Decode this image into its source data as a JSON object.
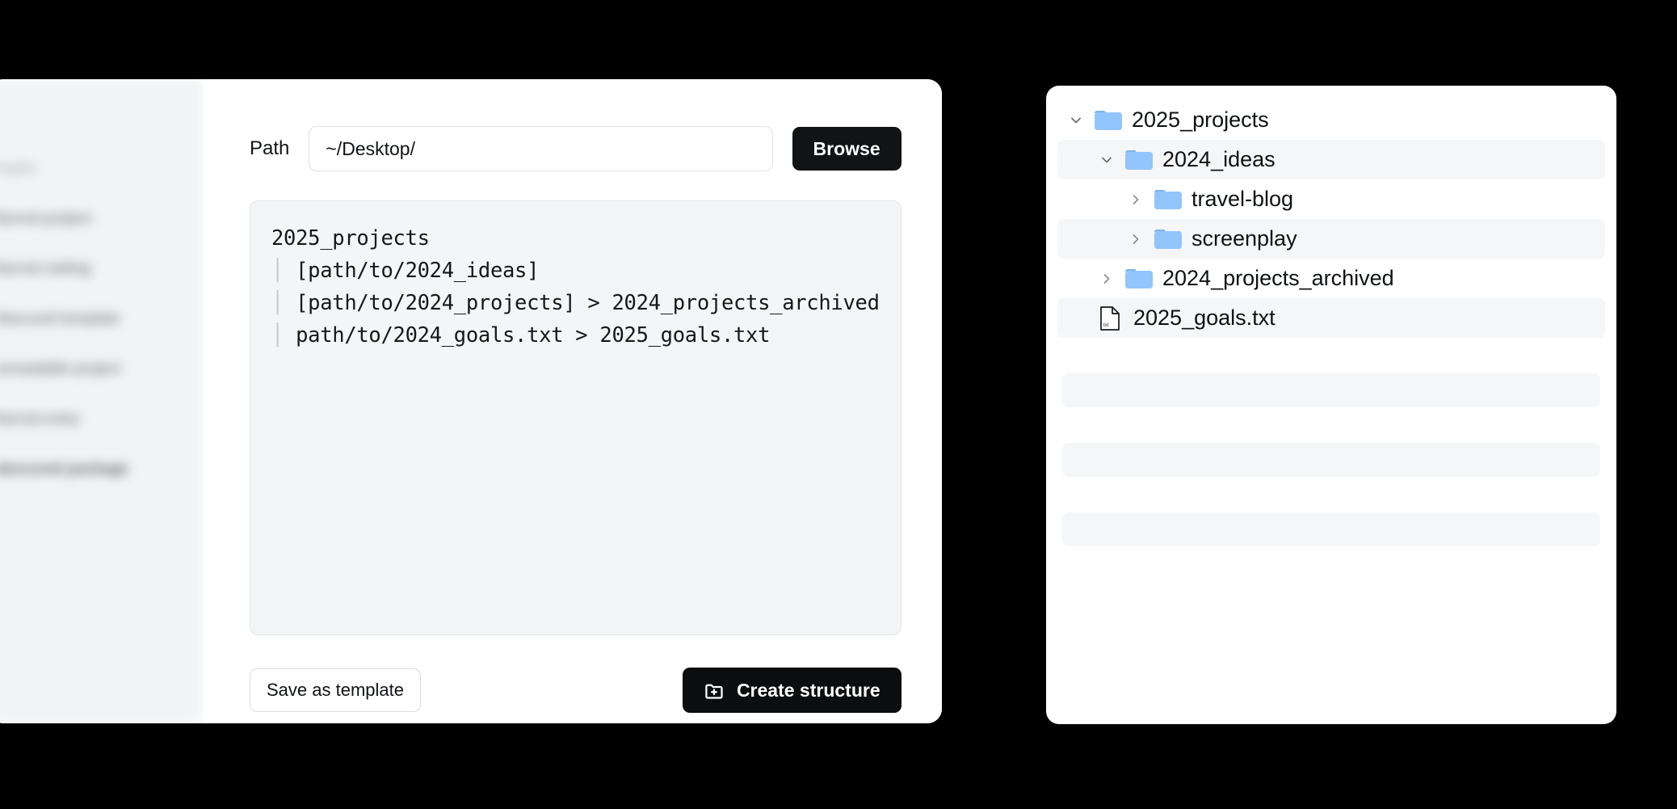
{
  "background_color": "#000000",
  "app_window": {
    "sidebar": {
      "blurred": true,
      "items": [
        {
          "label": "illegible"
        },
        {
          "label": "blurred project"
        },
        {
          "label": "blurred setting"
        },
        {
          "label": "obscured template"
        },
        {
          "label": "unreadable project"
        },
        {
          "label": "blurred entry"
        },
        {
          "label": "obscured package"
        }
      ]
    },
    "path_row": {
      "label": "Path",
      "input_value": "~/Desktop/",
      "input_placeholder": "~/Desktop/",
      "browse_label": "Browse"
    },
    "structure_editor": {
      "lines": [
        {
          "guide": "",
          "text": "2025_projects"
        },
        {
          "guide": "│ ",
          "text": "[path/to/2024_ideas]"
        },
        {
          "guide": "│ ",
          "text": "[path/to/2024_projects] > 2024_projects_archived"
        },
        {
          "guide": "│ ",
          "text": "path/to/2024_goals.txt > 2025_goals.txt"
        }
      ]
    },
    "footer": {
      "save_template_label": "Save as template",
      "create_structure_label": "Create structure",
      "create_structure_icon": "folder-plus-icon"
    }
  },
  "tree_panel": {
    "nodes": [
      {
        "chevron": "chevron-down-icon",
        "icon": "folder-icon",
        "label": "2025_projects",
        "indent": 0,
        "highlighted": false
      },
      {
        "chevron": "chevron-down-icon",
        "icon": "folder-icon",
        "label": "2024_ideas",
        "indent": 1,
        "highlighted": true
      },
      {
        "chevron": "chevron-right-icon",
        "icon": "folder-icon",
        "label": "travel-blog",
        "indent": 2,
        "highlighted": false
      },
      {
        "chevron": "chevron-right-icon",
        "icon": "folder-icon",
        "label": "screenplay",
        "indent": 2,
        "highlighted": true
      },
      {
        "chevron": "chevron-right-icon",
        "icon": "folder-icon",
        "label": "2024_projects_archived",
        "indent": 1,
        "highlighted": false
      },
      {
        "chevron": "",
        "icon": "file-icon",
        "label": "2025_goals.txt",
        "indent": 0,
        "highlighted": true
      }
    ],
    "placeholder_rows": 3
  },
  "colors": {
    "folder_body": "#93c5fd",
    "folder_tab": "#7cb4e8",
    "accent_dark": "#111315",
    "row_highlight": "#f5f6f7",
    "editor_bg": "#f4f5f6"
  }
}
